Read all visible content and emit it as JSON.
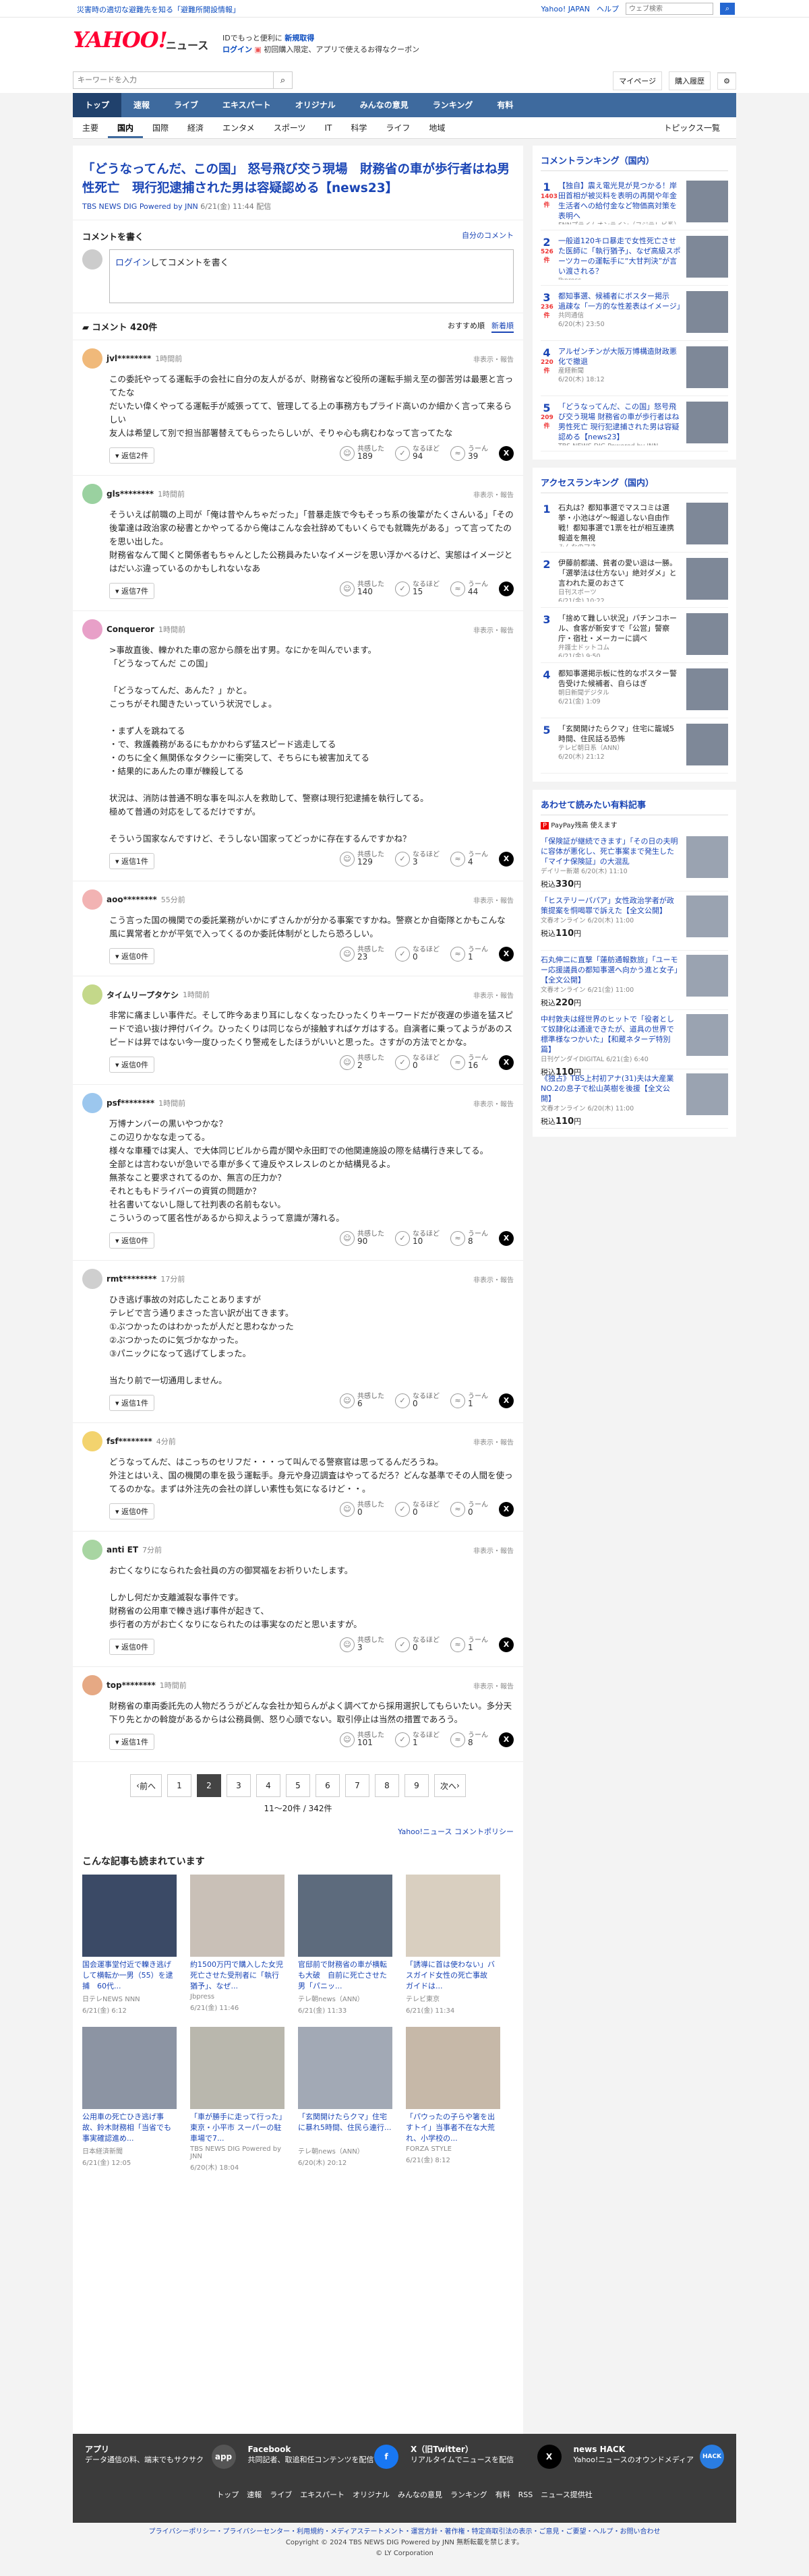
{
  "topbar": {
    "alert": "災害時の適切な避難先を知る「避難所開設情報」",
    "yahoo_japan": "Yahoo! JAPAN",
    "help": "ヘルプ",
    "search_placeholder": "ウェブ検索"
  },
  "masthead": {
    "logo": "YAHOO!",
    "section": "ニュース",
    "promo_line1": "IDでもっと便利に",
    "promo_bold": "新規取得",
    "promo_line2a": "ログイン",
    "promo_line2b": "初回購入限定、アプリで使えるお得なクーポン"
  },
  "search": {
    "placeholder": "キーワードを入力",
    "mypage": "マイページ",
    "purchase": "購入履歴"
  },
  "gnav": [
    "トップ",
    "速報",
    "ライブ",
    "エキスパート",
    "オリジナル",
    "みんなの意見",
    "ランキング",
    "有料"
  ],
  "snav": [
    "主要",
    "国内",
    "国際",
    "経済",
    "エンタメ",
    "スポーツ",
    "IT",
    "科学",
    "ライフ",
    "地域"
  ],
  "snav_topics": "トピックス一覧",
  "article": {
    "title": "「どうなってんだ、この国」 怒号飛び交う現場　財務省の車が歩行者はね男性死亡　現行犯逮捕された男は容疑認める【news23】",
    "source": "TBS NEWS DIG Powered by JNN",
    "date": "6/21(金) 11:44 配信"
  },
  "comment_write": {
    "heading": "コメントを書く",
    "own_comments": "自分のコメント",
    "login_link": "ログイン",
    "prompt": "してコメントを書く"
  },
  "comment_list": {
    "title": "コメント 420件",
    "sort_recommended": "おすすめ順",
    "sort_new": "新着順"
  },
  "comments": [
    {
      "name": "jvl********",
      "time": "1時間前",
      "report": "非表示・報告",
      "body": "この委託やってる運転手の会社に自分の友人がるが、財務省など役所の運転手揃え至の御苦労は最悪と言ってたな\nだいたい偉くやってる運転手が威張ってて、管理してる上の事務方もプライド高いのか細かく言って来るらしい\n友人は希望して別で担当部署替えてもらったらしいが、そりゃ心も病むわなって言ってたな",
      "reply": "返信2件",
      "r1": "189",
      "r2": "94",
      "r3": "39"
    },
    {
      "name": "gls********",
      "time": "1時間前",
      "report": "非表示・報告",
      "body": "そういえば前職の上司が「俺は昔やんちゃだった」「昔暴走族で今もそっち系の後輩がたくさんいる」「その後輩達は政治家の秘書とかやってるから俺はこんな会社辞めてもいくらでも就職先がある」って言ってたのを思い出した。\n財務省なんて聞くと関係者もちゃんとした公務員みたいなイメージを思い浮かべるけど、実態はイメージとはだいぶ違っているのかもしれないなあ",
      "reply": "返信7件",
      "r1": "140",
      "r2": "15",
      "r3": "44"
    },
    {
      "name": "Conqueror",
      "time": "1時間前",
      "report": "非表示・報告",
      "body": ">事故直後、轢かれた車の窓から顔を出す男。なにかを叫んでいます。\n「どうなってんだ この国」\n\n「どうなってんだ、あんた？」かと。\nこっちがそれ聞きたいっていう状況でしょ。\n\n・まず人を跳ねてる\n・で、救護義務があるにもかかわらず猛スピード逃走してる\n・のちに全く無関係なタクシーに衝突して、そちらにも被害加えてる\n・結果的にあんたの車が轢殺してる\n\n状況は、消防は普通不明な事を叫ぶ人を救助して、警察は現行犯逮捕を執行してる。\n極めて普通の対応をしてるだけですが。\n\nそういう国家なんですけど、そうしない国家ってどっかに存在するんですかね？",
      "reply": "返信1件",
      "r1": "129",
      "r2": "3",
      "r3": "4"
    },
    {
      "name": "aoo********",
      "time": "55分前",
      "report": "非表示・報告",
      "body": "こう言った国の機関での委託業務がいかにずさんかが分かる事案ですかね。警察とか自衛隊とかもこんな風に異常者とかが平気で入ってくるのか委託体制がとしたら恐ろしい。",
      "reply": "返信0件",
      "r1": "23",
      "r2": "0",
      "r3": "1"
    },
    {
      "name": "タイムリープタケシ",
      "time": "1時間前",
      "report": "非表示・報告",
      "body": "非常に痛ましい事件だ。そして昨今あまり耳にしなくなったひったくりキーワードだが夜遅の歩道を猛スピードで追い抜け押付バイク。ひったくりは同じならが接触すればケガはする。自演者に乗ってようがあのスピードは昇ではない今一度ひったくり警戒をしたほうがいいと思った。さすがの方法でとかな。",
      "reply": "返信0件",
      "r1": "2",
      "r2": "0",
      "r3": "16"
    },
    {
      "name": "psf********",
      "time": "1時間前",
      "report": "非表示・報告",
      "body": "万博ナンバーの黒いやつかな？\nこの辺りかなな走ってる。\n様々な車種では実人、で大体同じビルから霞が関や永田町での他関連施設の際を結構行き来してる。\n全部とは言わないが急いでる車が多くて違反やスレスレのとか結構見るよ。\n無茶なこと要求されてるのか、無言の圧力か？\nそれとももドライバーの資質の問題か？\n社名書いてないし隠して社判表の名前もない。\nこういうのって匿名性があるから抑えようって意識が薄れる。",
      "reply": "返信0件",
      "r1": "90",
      "r2": "10",
      "r3": "8"
    },
    {
      "name": "rmt********",
      "time": "17分前",
      "report": "非表示・報告",
      "body": "ひき逃げ事故の対応したことありますが\nテレビで言う通りまさった言い訳が出てきます。\n①ぶつかったのはわかったが人だと思わなかった\n②ぶつかったのに気づかなかった。\n③パニックになって逃げてしまった。\n\n当たり前で一切通用しません。",
      "reply": "返信1件",
      "r1": "6",
      "r2": "0",
      "r3": "1"
    },
    {
      "name": "fsf********",
      "time": "4分前",
      "report": "非表示・報告",
      "body": "どうなってんだ、はこっちのセリフだ・・・って叫んでる警察官は思ってるんだろうね。\n外注とはいえ、国の機関の車を扱う運転手。身元や身辺調査はやってるだろ？どんな基準でその人間を使ってるのかな。まずは外注先の会社の詳しい素性も気になるけど・・。",
      "reply": "返信0件",
      "r1": "0",
      "r2": "0",
      "r3": "0"
    },
    {
      "name": "anti ET",
      "time": "7分前",
      "report": "非表示・報告",
      "body": "お亡くなりになられた会社員の方の御冥福をお祈りいたします。\n\nしかし何だか支離滅裂な事件です。\n財務省の公用車で轢き逃げ事件が起きて、\n歩行者の方がお亡くなりになられたのは事実なのだと思いますが。",
      "reply": "返信0件",
      "r1": "3",
      "r2": "0",
      "r3": "1"
    },
    {
      "name": "top********",
      "time": "1時間前",
      "report": "非表示・報告",
      "body": "財務省の車両委託先の人物だろうがどんな会社か知らんがよく調べてから採用選択してもらいたい。多分天下り先とかの斡旋があるからは公務員側、怒り心頭でない。取引停止は当然の措置であろう。",
      "reply": "返信1件",
      "r1": "101",
      "r2": "1",
      "r3": "8"
    }
  ],
  "reaction_labels": {
    "l1": "共感した",
    "l2": "なるほど",
    "l3": "うーん"
  },
  "pager": {
    "prev": "前へ",
    "next": "次へ",
    "pages": [
      "1",
      "2",
      "3",
      "4",
      "5",
      "6",
      "7",
      "8",
      "9"
    ],
    "current": "2",
    "count": "11〜20件 / 342件"
  },
  "policy": "Yahoo!ニュース コメントポリシー",
  "related": {
    "heading": "こんな記事も読まれています",
    "items": [
      {
        "title": "国会運事堂付近で轢き逃げして横転か一男（55）を逮捕　60代...",
        "meta": "日テレNEWS NNN",
        "date": "6/21(金) 6:12"
      },
      {
        "title": "約1500万円で購入した女児死亡させた受刑者に「執行猶予」、なぜ...",
        "meta": "Jbpress",
        "date": "6/21(金) 11:46"
      },
      {
        "title": "官邸前で財務省の車が横転も大破　自前に死亡させた男「パニッ...",
        "meta": "テレ朝news（ANN）",
        "date": "6/21(金) 11:33"
      },
      {
        "title": "「誘導に首は使わない」バスガイド女性の死亡事故　ガイドは...",
        "meta": "テレビ東京",
        "date": "6/21(金) 11:34"
      },
      {
        "title": "公用車の死亡ひき逃げ事故、鈴木財務相「当省でも事実確認進め...",
        "meta": "日本経済新聞",
        "date": "6/21(金) 12:05"
      },
      {
        "title": "「車が勝手に走って行った」東京・小平市 スーパーの駐車場で7...",
        "meta": "TBS NEWS DIG Powered by JNN",
        "date": "6/20(木) 18:04"
      },
      {
        "title": "「玄関開けたらクマ」住宅に暴れ5時間、住民ら連行...",
        "meta": "テレ朝news（ANN）",
        "date": "6/20(木) 20:12"
      },
      {
        "title": "「パウったの子らや箸を出すトイ」当事者不在な大荒れ、小学校の...",
        "meta": "FORZA STYLE",
        "date": "6/21(金) 8:12"
      }
    ]
  },
  "side": {
    "ranking_title": "コメントランキング（国内）",
    "ranking": [
      {
        "no": "1",
        "cnt": "1403",
        "cnt_label": "件",
        "title": "【独自】震え電光見が見つかる！岸田首相が被災料を表明の再開や年金生活者への給付金など物価高対策を表明へ",
        "src": "FNNプライムオンライン（フジテレビ系）",
        "date": "6/21(金) 11:39"
      },
      {
        "no": "2",
        "cnt": "526",
        "cnt_label": "件",
        "title": "一般道120キロ暴走で女性死亡させた医師に「執行猶予」、なぜ高級スポーツカーの運転手に“大甘判決”が言い渡される？",
        "src": "Jbpress",
        "date": "6/21(金) 11:48"
      },
      {
        "no": "3",
        "cnt": "236",
        "cnt_label": "件",
        "title": "都知事選、候補者にボスター掲示　過疎な「一方的な性差表はイメージ」",
        "src": "共同通信",
        "date": "6/20(木) 23:50"
      },
      {
        "no": "4",
        "cnt": "220",
        "cnt_label": "件",
        "title": "アルゼンチンが大阪万博構造財政悪化で撤退",
        "src": "産経新聞",
        "date": "6/20(木) 18:12"
      },
      {
        "no": "5",
        "cnt": "209",
        "cnt_label": "件",
        "title": "「どうなってんだ、この国」怒号飛び交う現場 財務省の車が歩行者はね男性死亡 現行犯逮捕された男は容疑認める【news23】",
        "src": "TBS NEWS DIG Powered by JNN",
        "date": "6/21(金) 11:44"
      }
    ],
    "access_title": "アクセスランキング（国内）",
    "access": [
      {
        "no": "1",
        "title": "石丸は？都知事選でマスコミは選挙・小池はゲ〜報道しない自由作戦！都知事選で1票を社が相互連携報道を無視",
        "src": "みんなのマネ",
        "date": "6/21(金) 9:10"
      },
      {
        "no": "2",
        "title": "伊藤前都議、貧者の愛い退は一勝。「選挙法は仕方ない」絶対ダメ」と言われた夏のおさて",
        "src": "日刊スポーツ",
        "date": "6/21(金) 10:22"
      },
      {
        "no": "3",
        "title": "「捨めて難しい状況」パチンコホール、食客が新安すで「公営」警察庁・宿社・メーカーに調べ",
        "src": "弁護士ドットコム",
        "date": "6/21(金) 9:50"
      },
      {
        "no": "4",
        "title": "都知事選掲示板に性的なポスター警告受けた候補者、自らはぎ",
        "src": "朝日新聞デジタル",
        "date": "6/21(金) 1:09"
      },
      {
        "no": "5",
        "title": "「玄関開けたらクマ」住宅に籠城5時間、住民話る恐怖",
        "src": "テレビ朝日系（ANN）",
        "date": "6/20(木) 21:12"
      }
    ],
    "pay_title": "あわせて読みたい有料記事",
    "pay_sub": "PayPay残高 使えます",
    "pay": [
      {
        "title": "「保険証が継続できます」「その日の夫明に容体が悪化し、死亡事案まで発生した「マイナ保険証」の大混乱",
        "src": "デイリー新潮",
        "date": "6/20(木) 11:10",
        "price": "330"
      },
      {
        "title": "「ヒステリーパパア」女性政治学者が政策提案を恫喝罪で訴えた【全文公開】",
        "src": "文春オンライン",
        "date": "6/20(木) 11:00",
        "price": "110"
      },
      {
        "title": "石丸伸二に直撃「蓮舫通報数旅」「ユーモー応援議員の都知事選へ向かう進と女子」【全文公開】",
        "src": "文春オンライン",
        "date": "6/21(金) 11:00",
        "price": "220"
      },
      {
        "title": "中村敦夫は経世界のヒットで「役者として奴隷化は通達できたが、道具の世界で標準様なつかいた」【和蔵ネターデ特別篇】",
        "src": "日刊ゲンダイDIGITAL",
        "date": "6/21(金) 6:40",
        "price": "110"
      },
      {
        "title": "《独占》TBS上村初アナ(31)夫は大産業NO.2の息子で松山英樹を後援【全文公開】",
        "src": "文春オンライン",
        "date": "6/20(木) 11:00",
        "price": "110"
      }
    ],
    "price_prefix": "税込",
    "price_suffix": "円"
  },
  "footer": {
    "cols": [
      {
        "title": "アプリ",
        "desc": "データ通信の料、端末でもサクサク",
        "icon": "app"
      },
      {
        "title": "Facebook",
        "desc": "共同記者、取追和任コンテンツを配信",
        "icon": "f"
      },
      {
        "title": "X（旧Twitter）",
        "desc": "リアルタイムでニュースを配信",
        "icon": "X"
      },
      {
        "title": "news HACK",
        "desc": "Yahoo!ニュースのオウンドメディア",
        "icon": "HACK"
      }
    ],
    "nav": [
      "トップ",
      "速報",
      "ライブ",
      "エキスパート",
      "オリジナル",
      "みんなの意見",
      "ランキング",
      "有料",
      "RSS",
      "ニュース提供社"
    ],
    "legal1": "プライバシーポリシー・プライバシーセンター・利用規約・メディアステートメント・運営方針・著作権・特定商取引法の表示・ご意見・ご要望・ヘルプ・お問い合わせ",
    "legal2": "Copyright © 2024 TBS NEWS DIG Powered by JNN 無断転載を禁じます。",
    "legal3": "© LY Corporation"
  }
}
